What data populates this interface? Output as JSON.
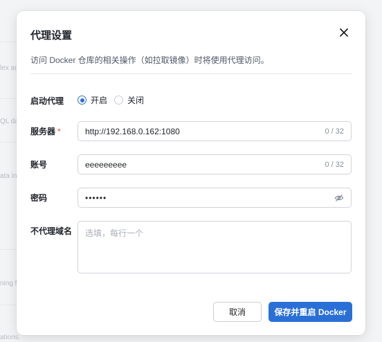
{
  "background": {
    "fragments": [
      "lex an",
      "QL da",
      "ata int",
      "ning f",
      "ations."
    ]
  },
  "dialog": {
    "title": "代理设置",
    "description": "访问 Docker 仓库的相关操作（如拉取镜像）时将使用代理访问。",
    "enable_proxy": {
      "label": "启动代理",
      "options": [
        "开启",
        "关闭"
      ],
      "selected": "开启"
    },
    "server": {
      "label": "服务器",
      "required_mark": "*",
      "value": "http://192.168.0.162:1080",
      "counter": "0 / 32"
    },
    "account": {
      "label": "账号",
      "value": "eeeeeeeee",
      "counter": "0 / 32"
    },
    "password": {
      "label": "密码",
      "masked_value": "••••••"
    },
    "no_proxy": {
      "label": "不代理域名",
      "placeholder": "选填，每行一个"
    },
    "buttons": {
      "cancel": "取消",
      "save": "保存并重启 Docker"
    },
    "colors": {
      "primary": "#2a6fd6",
      "required": "#f53f3f"
    }
  }
}
